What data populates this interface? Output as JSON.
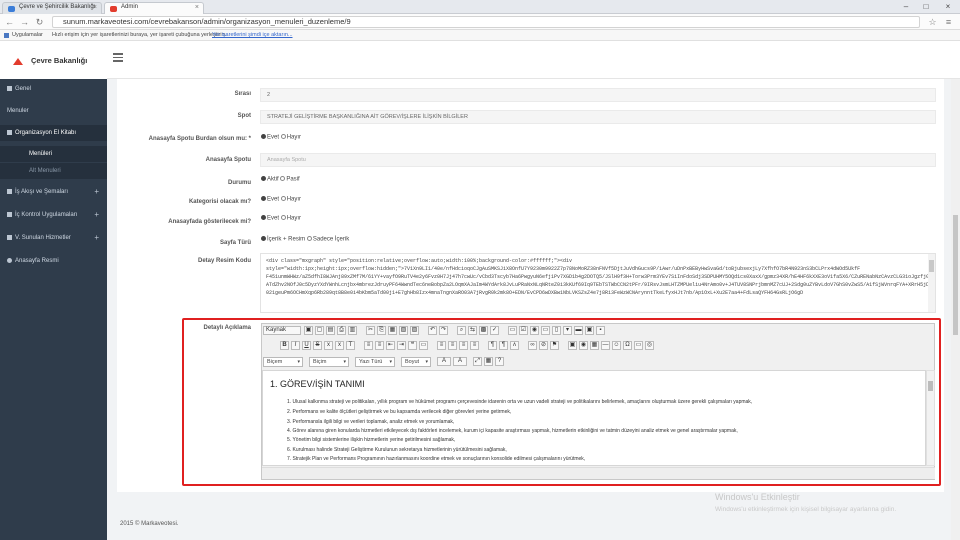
{
  "browser": {
    "tabs": [
      {
        "label": "Çevre ve Şehircilik Bakanlığı",
        "favicon_color": "#3b7dd8"
      },
      {
        "label": "Admin",
        "favicon_color": "#e23c2d"
      }
    ],
    "url": "sunum.markaveotesi.com/cevrebakanson/admin/organizasyon_menuleri_duzenleme/9",
    "bookmarks_label": "Uygulamalar",
    "bookmarks_hint": "Hızlı erişim için yer işaretlerinizi buraya, yer işareti çubuğuna yerleştirin.",
    "bookmarks_link": "Yer işaretlerini şimdi içe aktarın..."
  },
  "brand": {
    "name": "Çevre Bakanlığı",
    "logo_color": "#e23c2d"
  },
  "sidebar": {
    "items": [
      {
        "label": "Genel"
      },
      {
        "label": "Menuler"
      },
      {
        "label": "Organizasyon El Kitabı",
        "active": true
      },
      {
        "label": "İş Akışı ve Şemaları",
        "plus": "+"
      },
      {
        "label": "İç Kontrol Uygulamaları",
        "plus": "+"
      },
      {
        "label": "V. Sunulan Hizmetler",
        "plus": "+"
      },
      {
        "label": "Anasayfa Resmi"
      }
    ],
    "subitems": [
      {
        "label": "Menüleri"
      },
      {
        "label": "Alt Menuleri"
      }
    ]
  },
  "form": {
    "sira": {
      "label": "Sırası",
      "value": "2"
    },
    "spot": {
      "label": "Spot",
      "value": "STRATEJİ GELİŞTİRME BAŞKANLIĞINA AİT GÖREV/İŞLERE İLİŞKİN BİLGİLER"
    },
    "anasayfa_spotu_burdan": {
      "label": "Anasayfa Spotu Burdan olsun mu: *",
      "option_yes": "Evet",
      "option_no": "Hayır"
    },
    "anasayfa_spotu": {
      "label": "Anasayfa Spotu",
      "placeholder": "Anasayfa Spotu"
    },
    "durumu": {
      "label": "Durumu",
      "option_yes": "Aktif",
      "option_no": "Pasif"
    },
    "kategorisi": {
      "label": "Kategorisi olacak mı?",
      "option_yes": "Evet",
      "option_no": "Hayır"
    },
    "anasayfada": {
      "label": "Anasayfada gösterilecek mi?",
      "option_yes": "Evet",
      "option_no": "Hayır"
    },
    "sayfa_turu": {
      "label": "Sayfa Türü",
      "option_yes": "İçerik + Resim",
      "option_no": "Sadece İçerik"
    },
    "detay_resim_kodu": {
      "label": "Detay Resim Kodu",
      "value": "<div class=\"mxgraph\" style=\"position:relative;overflow:auto;width:100%;background-color:#ffffff;\"><div\nstyle=\"width:1px;height:1px;overflow:hidden;\">7V1Xn9LI1/40e/nfHdcioqoCJgAuSMKSJiX8OnfU7Y9230m9922Z7p78NoMoRZ38nFNVf5DjtJuVdhGucs9P/iAwr/uDnPxBEByHwSvaGd/toBjubsexjLy7XfhfO7bR4N923nS3bCLPrx4dWOd5UkfF\nF451unmWHWz/aZ5dfhI8WJAnj89xZMf7M/61YY+vayfO9RuTV4e2y6Fvz0H7Jj47h7cwUc/vCbd3Tscyb7Ha6PwgyuN6efj1Pv7XGD1b4g2DOTQ5/JSlH9f3H+Torw3Prm3YEv7SiInFdoSdj3SDPUHMY5OQd1cs0XaxX/gpmz34XR/hE4HF6kXXE3oV1fa5X6/CZuRENabNzCAvzCLG31oJgzfjGZgoLXsAzS18KB2NDu26SaaHD8cIgEmzzc8m49i5WyivUzNzWXrl6Z8vzYmWdqpm3n1cVft)DKRIjR0VF2++t/k5Vp/EMLYObIL4TJHH03xIFn+RMKL/TaLFcbIx0Ec+uLqMhyqcD8btrO2iA70GQ4Wpap\nATdZhv2NOfJ0c5DyzYXdYWnhLcnjbx4mbrezJdruyPF64WwndTec6neBobpZa2LOqmXAJaIm4WYdArk8JvLuPRaNxNLqNRteZ0i3kKUf69Iq9TEbTSTWbCCN2tPFr/9IRsvJsmLHTZMPUeliu4NrAmo0v+J4TUV8SNPrjbmnMZ7cUJ+2Sdg0uZYBvLdoV7GhS0vZwS5/A1fSjWVnrqFYA+XRrH5jDQ3dZ8CiXZ06N6XvVzCKcgxHZK7n2Z/HbDDeXm+2p8tbhnbnIY1XgdvoFLQWSeOdHI1HY6rHpfQ\n021geuPm6OCHmXqp6Rb289qt8B8e0i4bKbm5aTd00j1+E7ghHb8Izx4mnaTngnXaRO03A7jRvgR0k2mk8O+EDN/EvCPD6wDXBw1NbLVKSZsZ4e7j8Ri3FeWzWCNArynntTkeLfyxHJt7nb/Ap1OxL+Xu2E7aa4+FdLsaQYFH64GsRLjO6gD"
    },
    "detayli_aciklama": {
      "label": "Detaylı Açıklama"
    }
  },
  "editor": {
    "source_label": "Kaynak",
    "format_label": "Biçem",
    "style_label": "Biçim",
    "font_label": "Yazı Türü",
    "size_label": "Boyut",
    "heading": "1. GÖREV/İŞİN TANIMI",
    "items": [
      "1. Ulusal kalkınma strateji ve politikaları, yıllık program ve hükümet programı çerçevesinde idarenin orta ve uzun vadeli strateji ve politikalarını belirlemek, amaçlarını oluşturmak üzere gerekli çalışmaları yapmak,",
      "2. Performans ve kalite ölçütleri geliştirmek ve bu kapsamda verilecek diğer görevleri yerine getirmek,",
      "3. Performansla ilgili bilgi ve verileri toplamak, analiz etmek ve yorumlamak,",
      "4. Görev alanına giren konularda hizmetleri etkileyecek dış faktörleri incelemek, kurum içi kapasite araştırması yapmak, hizmetlerin etkinliğini ve tatmin düzeyini analiz etmek ve genel araştırmalar yapmak,",
      "5. Yönetim bilgi sistemlerine ilişkin hizmetlerin yerine getirilmesini sağlamak,",
      "6. Kurulması halinde Strateji Geliştirme Kurulunun sekretarya hizmetlerinin yürütülmesini sağlamak,",
      "7. Stratejik Plan ve Performans Programının hazırlanmasını koordine etmek ve sonuçlarının konsolide edilmesi çalışmalarını yürütmek,"
    ]
  },
  "footer": {
    "copyright": "2015 © Markaveotesi."
  },
  "watermark": {
    "title": "Windows'u Etkinleştir",
    "subtitle": "Windows'u etkinleştirmek için kişisel bilgisayar ayarlarına gidin."
  },
  "colors": {
    "sidebar": "#2f3c4b",
    "highlight": "#e02020",
    "accent": "#e23c2d"
  }
}
